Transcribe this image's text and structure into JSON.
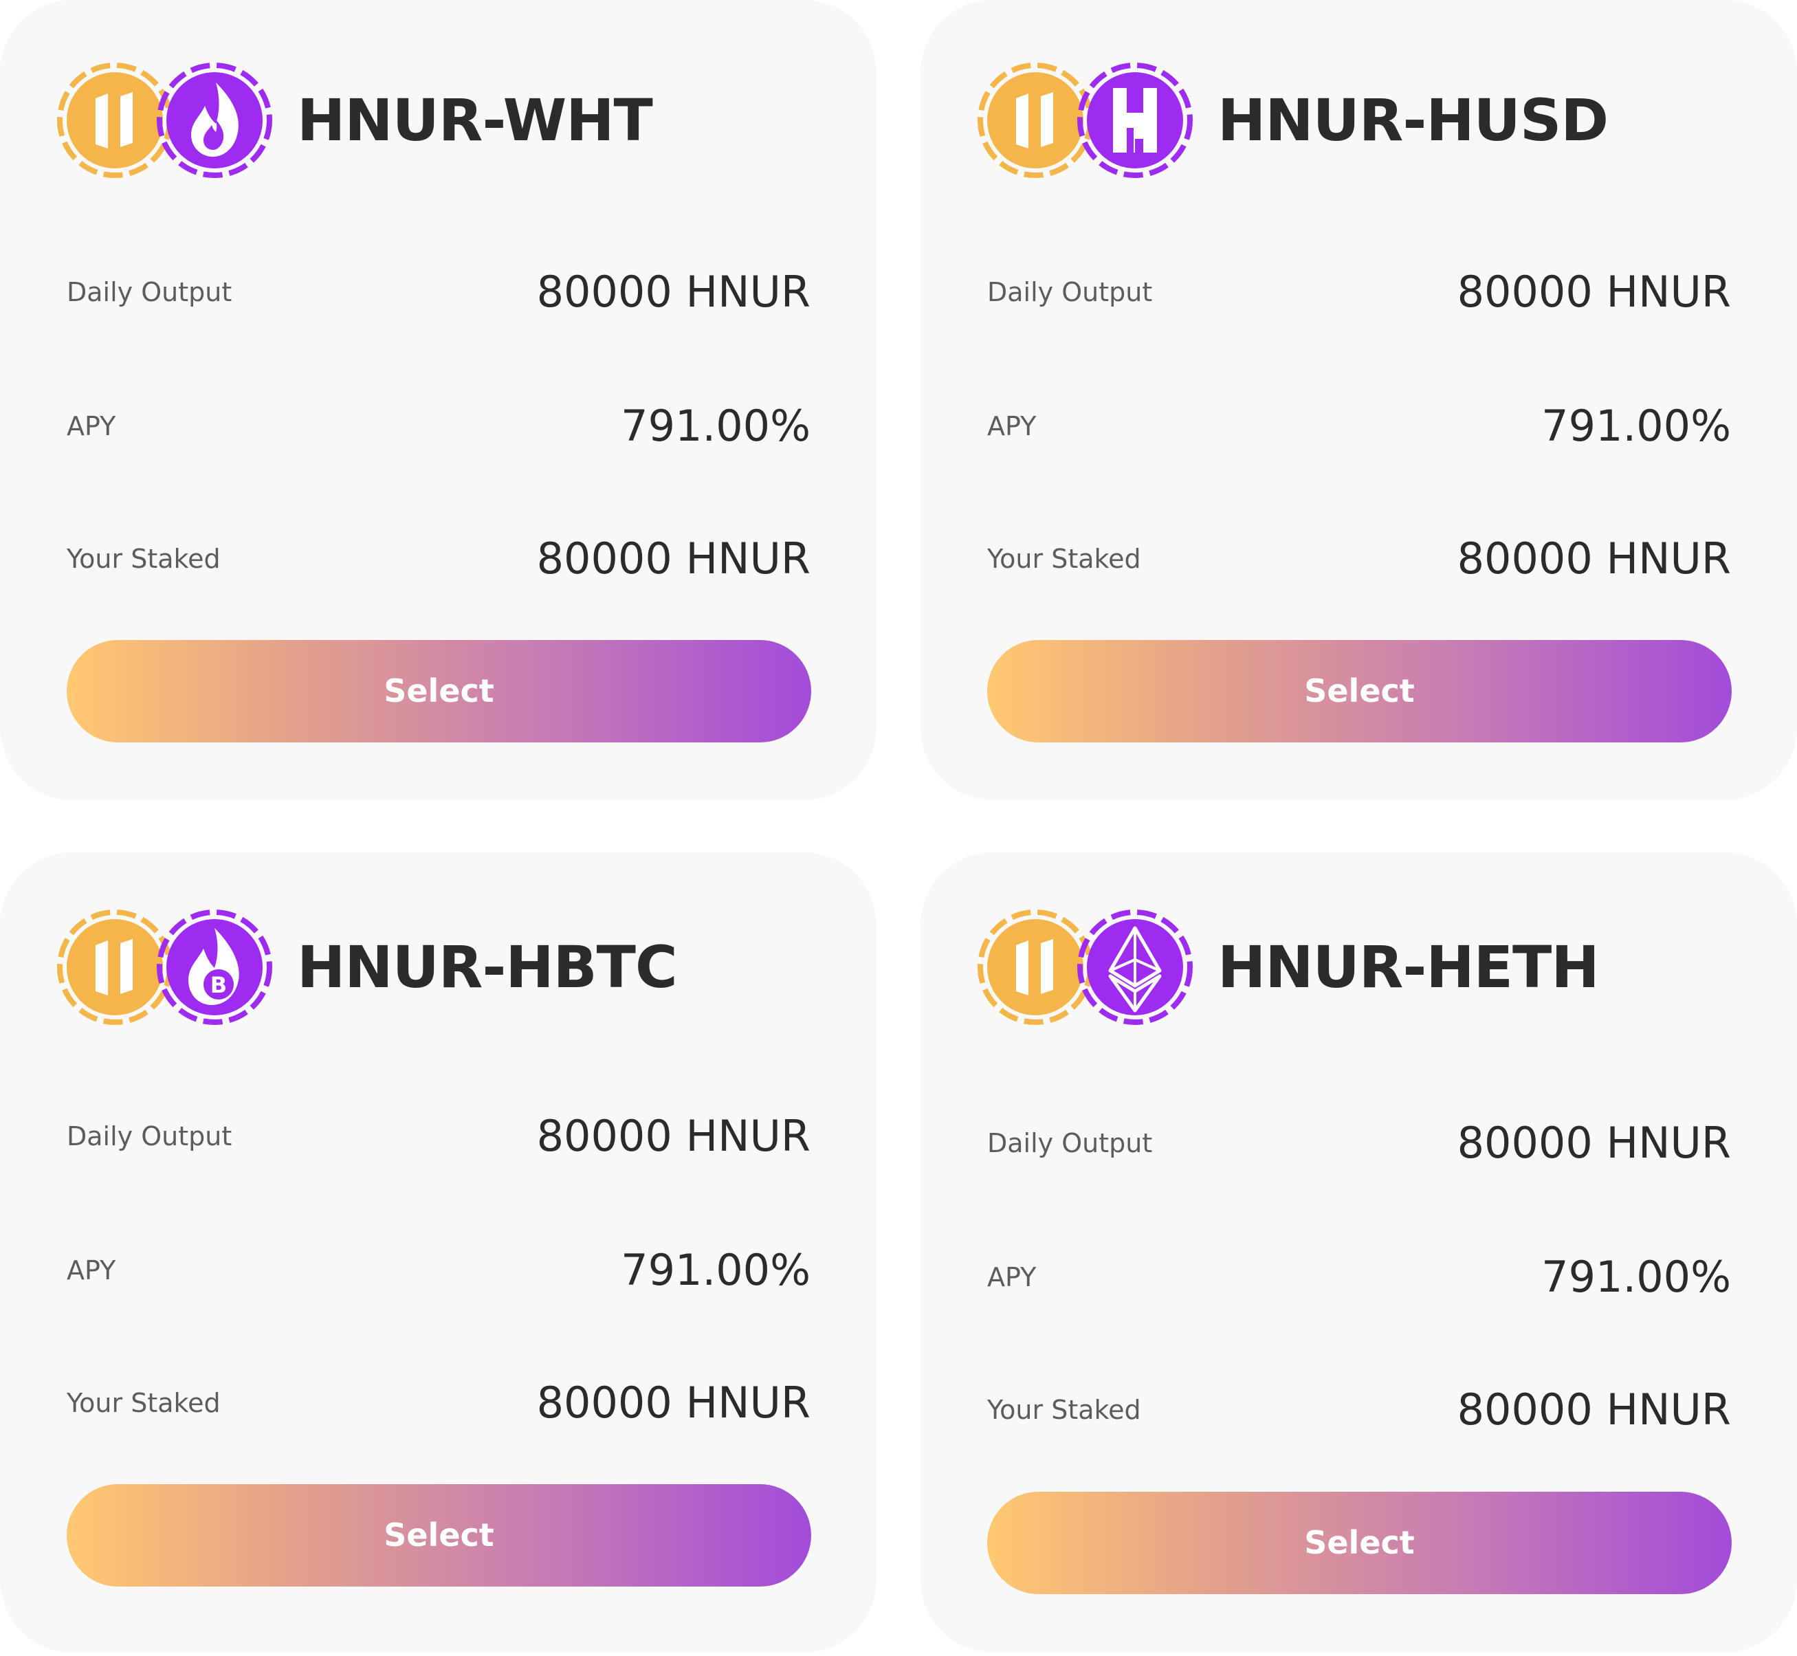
{
  "labels": {
    "daily_output": "Daily Output",
    "apy": "APY",
    "your_staked": "Your Staked",
    "select": "Select"
  },
  "colors": {
    "card_background": "#f8f8f8",
    "title_text": "#2b2b2b",
    "label_text": "#5c5c5c",
    "hnur_coin": "#f4b64a",
    "partner_coin": "#9d2cf0",
    "button_gradient_start": "#ffc870",
    "button_gradient_end": "#a24cd9"
  },
  "pools": [
    {
      "title": "HNUR-WHT",
      "base_icon": "hnur-coin-icon",
      "pair_icon": "flame-icon",
      "daily_output": "80000 HNUR",
      "apy": "791.00%",
      "your_staked": "80000 HNUR"
    },
    {
      "title": "HNUR-HUSD",
      "base_icon": "hnur-coin-icon",
      "pair_icon": "husd-h-icon",
      "daily_output": "80000 HNUR",
      "apy": "791.00%",
      "your_staked": "80000 HNUR"
    },
    {
      "title": "HNUR-HBTC",
      "base_icon": "hnur-coin-icon",
      "pair_icon": "flame-bitcoin-icon",
      "daily_output": "80000 HNUR",
      "apy": "791.00%",
      "your_staked": "80000 HNUR"
    },
    {
      "title": "HNUR-HETH",
      "base_icon": "hnur-coin-icon",
      "pair_icon": "ethereum-icon",
      "daily_output": "80000 HNUR",
      "apy": "791.00%",
      "your_staked": "80000 HNUR"
    }
  ]
}
